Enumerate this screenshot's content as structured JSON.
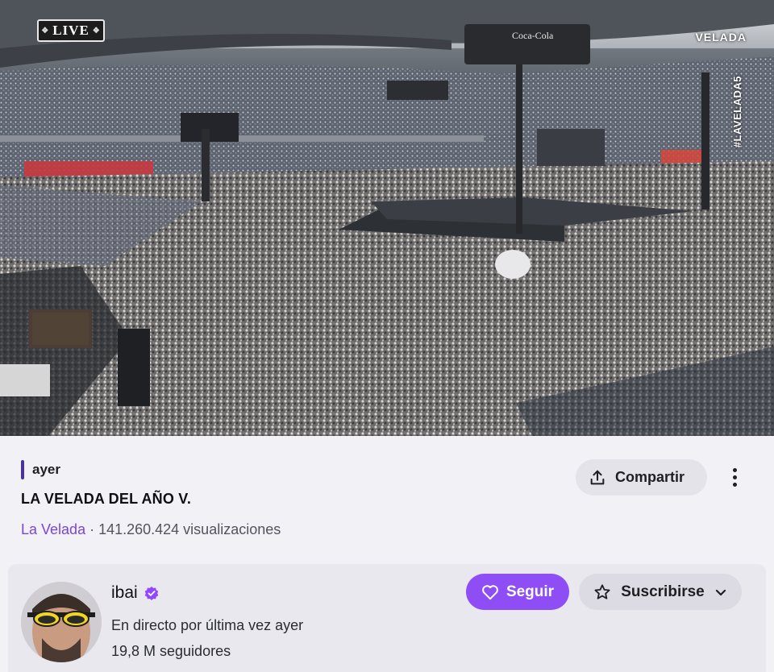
{
  "video": {
    "live_badge": "LIVE",
    "overlay_logo": "VELADA",
    "overlay_hashtag": "#LAVELADA5",
    "sponsor_text": "Coca-Cola"
  },
  "stream": {
    "date": "ayer",
    "title": "LA VELADA DEL AÑO V.",
    "category": "La Velada",
    "separator": " · ",
    "views": "141.260.424 visualizaciones",
    "share_label": "Compartir",
    "more_icon": "more-vertical-icon",
    "share_icon": "share-upload-icon"
  },
  "channel": {
    "name": "ibai",
    "verified_icon": "verified-badge-icon",
    "last_live": "En directo por última vez ayer",
    "followers": "19,8 M seguidores",
    "follow_label": "Seguir",
    "follow_icon": "heart-icon",
    "subscribe_label": "Suscribirse",
    "subscribe_icon": "star-icon",
    "subscribe_chevron": "chevron-down-icon"
  },
  "colors": {
    "accent": "#8f4df5",
    "category_link": "#7b44e0",
    "date_bar": "#4b3296",
    "page_bg": "#f2f1f6"
  }
}
